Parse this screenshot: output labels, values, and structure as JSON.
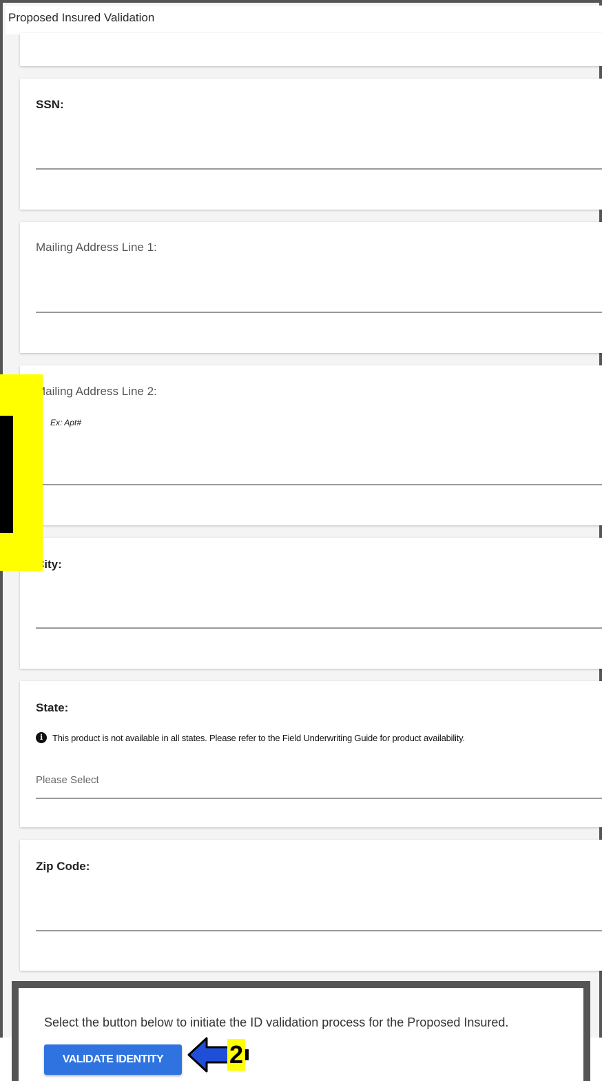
{
  "window": {
    "title": "Proposed Insured Validation"
  },
  "fields": {
    "ssn": {
      "label": "SSN:"
    },
    "address1": {
      "label": "Mailing Address Line 1:"
    },
    "address2": {
      "label": "Mailing Address Line 2:",
      "hint": "Ex: Apt#"
    },
    "city": {
      "label": "City:"
    },
    "state": {
      "label": "State:",
      "info": "This product is not available in all states. Please refer to the Field Underwriting Guide for product availability.",
      "selected": "Please Select"
    },
    "zip": {
      "label": "Zip Code:"
    }
  },
  "validation": {
    "instruction": "Select the button below to initiate the ID validation process for the Proposed Insured.",
    "button_label": "VALIDATE IDENTITY"
  },
  "annotations": {
    "step2": "2"
  },
  "colors": {
    "accent": "#2f73e0",
    "highlight": "#ffff00",
    "frame": "#555555"
  },
  "icons": [
    "info-icon",
    "arrow-left-icon"
  ]
}
